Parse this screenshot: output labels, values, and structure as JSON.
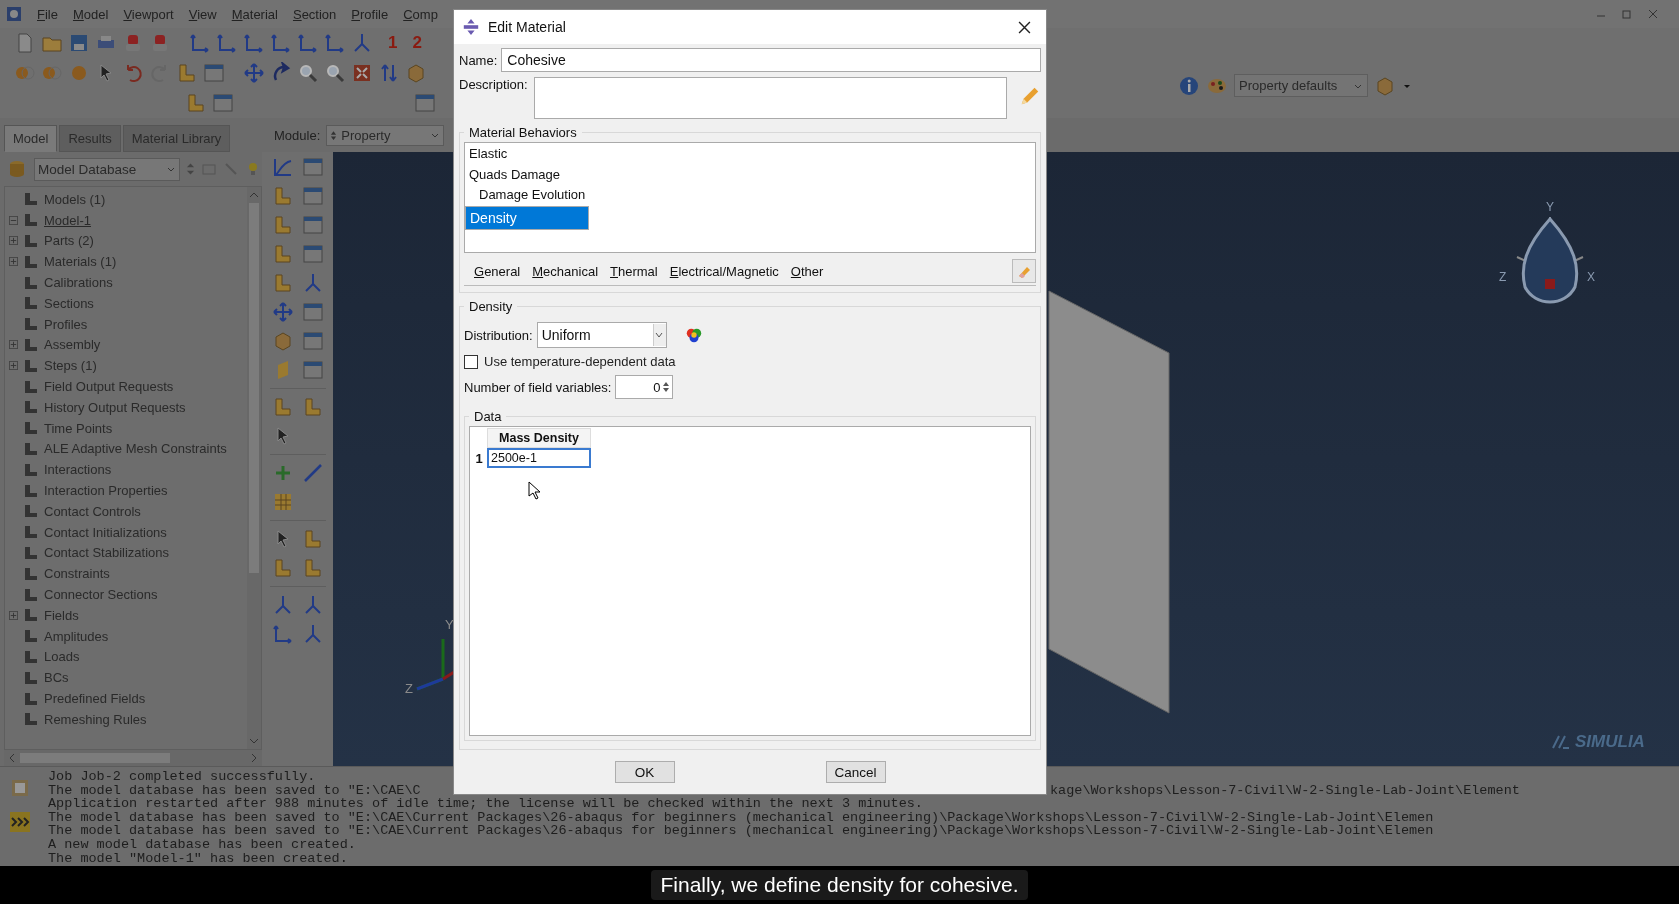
{
  "menu_bar": {
    "items": [
      "File",
      "Model",
      "Viewport",
      "View",
      "Material",
      "Section",
      "Profile",
      "Comp"
    ]
  },
  "toolbar": {
    "view_numbers": [
      "1",
      "2"
    ]
  },
  "right_toolbar": {
    "display_group": "Property defaults"
  },
  "left_panel": {
    "tabs": [
      {
        "label": "Model",
        "selected": true
      },
      {
        "label": "Results",
        "selected": false
      },
      {
        "label": "Material Library",
        "selected": false
      }
    ],
    "database": "Model Database",
    "tree": [
      {
        "label": "Models (1)",
        "children": [
          {
            "label": "Model-1",
            "expanded": true,
            "current": true,
            "children": [
              {
                "label": "Parts (2)",
                "expanded": false
              },
              {
                "label": "Materials (1)",
                "expanded": false
              },
              {
                "label": "Calibrations"
              },
              {
                "label": "Sections"
              },
              {
                "label": "Profiles"
              },
              {
                "label": "Assembly",
                "expanded": false
              },
              {
                "label": "Steps (1)",
                "expanded": false
              },
              {
                "label": "Field Output Requests"
              },
              {
                "label": "History Output Requests"
              },
              {
                "label": "Time Points"
              },
              {
                "label": "ALE Adaptive Mesh Constraints"
              },
              {
                "label": "Interactions"
              },
              {
                "label": "Interaction Properties"
              },
              {
                "label": "Contact Controls"
              },
              {
                "label": "Contact Initializations"
              },
              {
                "label": "Contact Stabilizations"
              },
              {
                "label": "Constraints"
              },
              {
                "label": "Connector Sections"
              },
              {
                "label": "Fields",
                "expanded": false
              },
              {
                "label": "Amplitudes"
              },
              {
                "label": "Loads"
              },
              {
                "label": "BCs"
              },
              {
                "label": "Predefined Fields"
              },
              {
                "label": "Remeshing Rules"
              }
            ]
          }
        ]
      }
    ]
  },
  "module": {
    "label": "Module:",
    "value": "Property"
  },
  "viewport": {
    "view_triad": {
      "y": "Y",
      "x": "X",
      "z": "Z"
    },
    "global_triad": {
      "y": "Y",
      "z": "Z"
    },
    "brand": "SIMULIA"
  },
  "message_area": {
    "lines": [
      {
        "text": "Job Job-2 completed successfully."
      },
      {
        "text": "The model database has been saved to \"E:\\CAE\\C",
        "continued": "kage\\Workshops\\Lesson-7-Civil\\W-2-Single-Lab-Joint\\Element"
      },
      {
        "text": "Application restarted after 988 minutes of idle time; the license will be checked within the next 3 minutes."
      },
      {
        "text": "The model database has been saved to \"E:\\CAE\\Current Packages\\26-abaqus for beginners (mechanical engineering)\\Package\\Workshops\\Lesson-7-Civil\\W-2-Single-Lab-Joint\\Elemen"
      },
      {
        "text": "The model database has been saved to \"E:\\CAE\\Current Packages\\26-abaqus for beginners (mechanical engineering)\\Package\\Workshops\\Lesson-7-Civil\\W-2-Single-Lab-Joint\\Elemen"
      },
      {
        "text": "A new model database has been created."
      },
      {
        "text": "The model \"Model-1\" has been created."
      }
    ]
  },
  "caption": "Finally, we define density for cohesive.",
  "dialog": {
    "title": "Edit Material",
    "name_label": "Name:",
    "name": "Cohesive",
    "description_label": "Description:",
    "behaviors_title": "Material Behaviors",
    "behaviors": [
      {
        "label": "Elastic",
        "selected": false
      },
      {
        "label": "Quads Damage",
        "selected": false,
        "children": [
          {
            "label": "Damage Evolution",
            "selected": false
          }
        ]
      },
      {
        "label": "Density",
        "selected": true
      }
    ],
    "menus": [
      "General",
      "Mechanical",
      "Thermal",
      "Electrical/Magnetic",
      "Other"
    ],
    "section_title": "Density",
    "distribution_label": "Distribution:",
    "distribution": "Uniform",
    "temperature_dependent": {
      "label": "Use temperature-dependent data",
      "checked": false
    },
    "field_variables_label": "Number of field variables:",
    "field_variables": "0",
    "data_title": "Data",
    "table": {
      "columns": [
        "Mass Density"
      ],
      "rows": [
        {
          "number": "1",
          "cells": [
            "2500e-1"
          ]
        }
      ]
    },
    "buttons": [
      "OK",
      "Cancel"
    ]
  }
}
